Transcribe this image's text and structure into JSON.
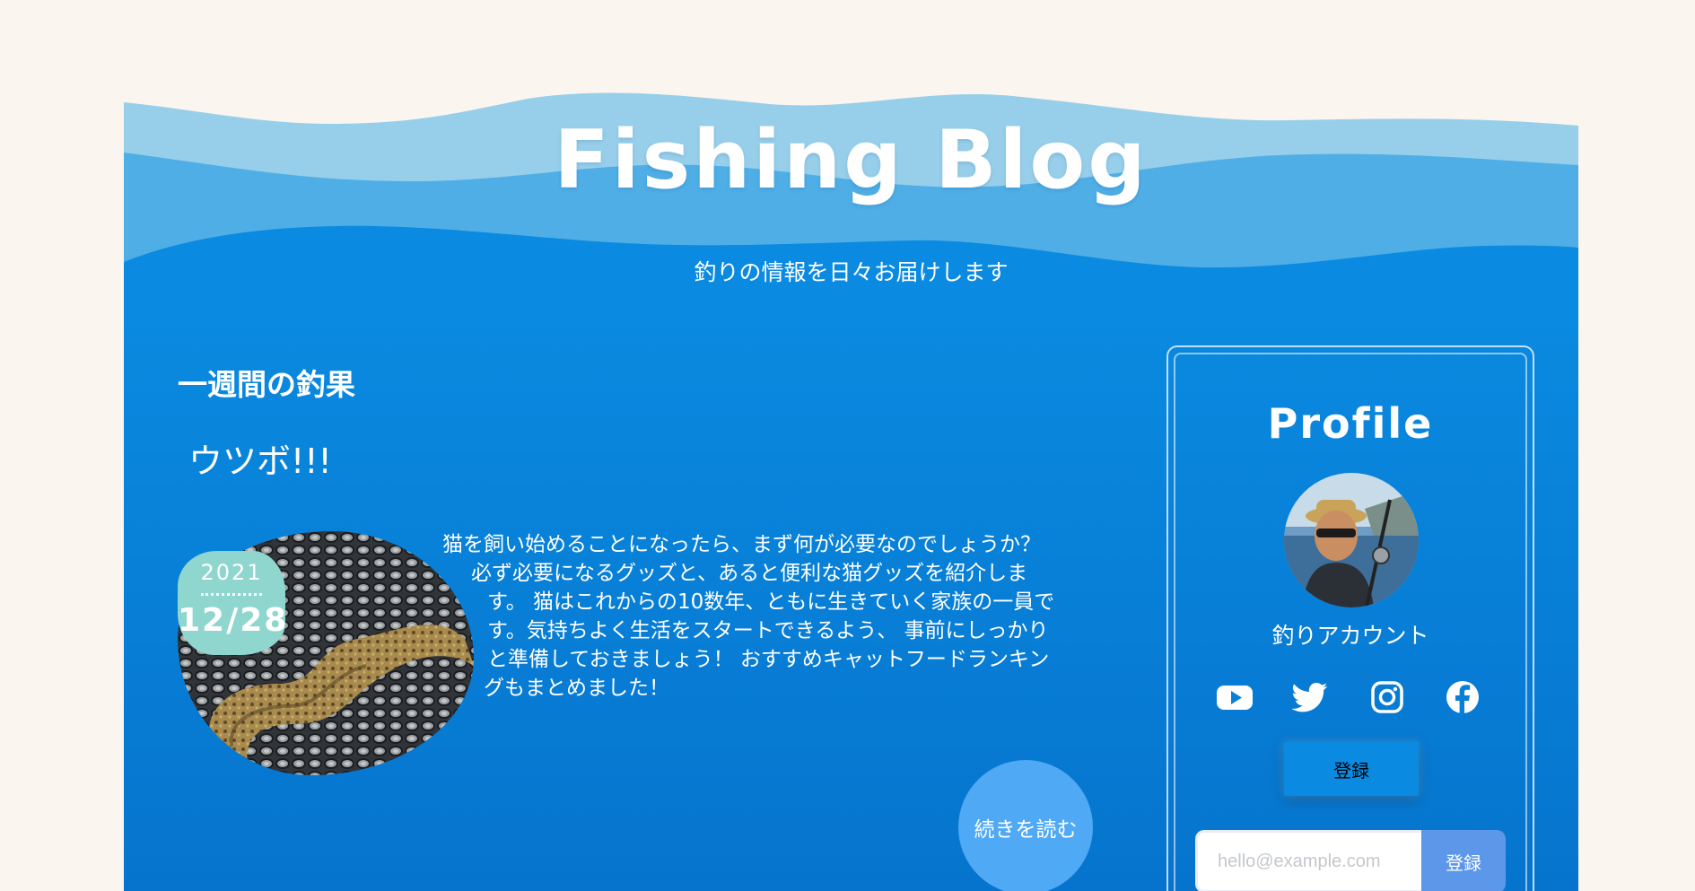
{
  "header": {
    "site_title": "Fishing Blog",
    "tagline": "釣りの情報を日々お届けします"
  },
  "post": {
    "section_heading": "一週間の釣果",
    "title": "ウツボ!!!",
    "date_year": "2021",
    "date_day": "12/28",
    "excerpt_lines": [
      "猫を飼い始めることになったら、まず何が必要なのでしょうか？",
      "必ず必要になるグッズと、あると便利な猫グッズを紹介しま",
      "す。 猫はこれからの10数年、ともに生きていく家族の一員で",
      "す。気持ちよく生活をスタートできるよう、 事前にしっかり",
      "と準備しておきましょう！ おすすめキャットフードランキン",
      "グもまとめました！"
    ],
    "read_more_label": "続きを読む"
  },
  "sidebar": {
    "profile_title": "Profile",
    "account_name": "釣りアカウント",
    "social_icons": [
      "youtube-icon",
      "twitter-icon",
      "instagram-icon",
      "facebook-icon"
    ],
    "subscribe_label": "登録",
    "email_placeholder": "hello@example.com",
    "email_submit_label": "登録"
  },
  "colors": {
    "page_background": "#faf5ee",
    "wave_light": "#97cfeb",
    "wave_mid": "#4faee6",
    "main_blue": "#0a8ae0",
    "date_badge": "#8fd6cf",
    "read_more": "#4fa9f4",
    "email_submit": "#5d97ea"
  }
}
